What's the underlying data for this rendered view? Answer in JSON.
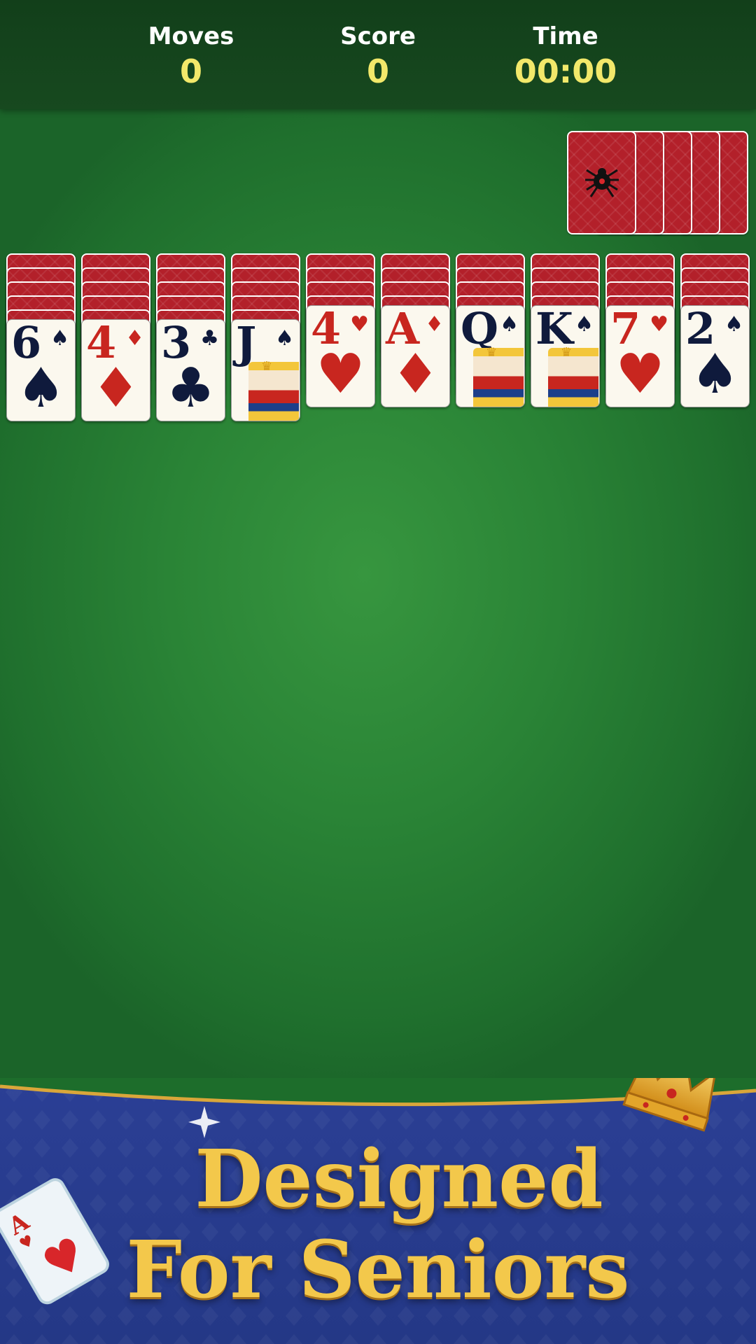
{
  "stats": {
    "moves_label": "Moves",
    "moves_value": "0",
    "score_label": "Score",
    "score_value": "0",
    "time_label": "Time",
    "time_value": "00:00"
  },
  "stock": {
    "piles": 5,
    "card_back": "red-spider-web"
  },
  "tableau": [
    {
      "facedown": 5,
      "rank": "6",
      "suit": "♠",
      "color": "black",
      "court": false
    },
    {
      "facedown": 5,
      "rank": "4",
      "suit": "♦",
      "color": "red",
      "court": false
    },
    {
      "facedown": 5,
      "rank": "3",
      "suit": "♣",
      "color": "black",
      "court": false
    },
    {
      "facedown": 5,
      "rank": "J",
      "suit": "♠",
      "color": "black",
      "court": true
    },
    {
      "facedown": 4,
      "rank": "4",
      "suit": "♥",
      "color": "red",
      "court": false
    },
    {
      "facedown": 4,
      "rank": "A",
      "suit": "♦",
      "color": "red",
      "court": false
    },
    {
      "facedown": 4,
      "rank": "Q",
      "suit": "♠",
      "color": "black",
      "court": true
    },
    {
      "facedown": 4,
      "rank": "K",
      "suit": "♠",
      "color": "black",
      "court": true
    },
    {
      "facedown": 4,
      "rank": "7",
      "suit": "♥",
      "color": "red",
      "court": false
    },
    {
      "facedown": 4,
      "rank": "2",
      "suit": "♠",
      "color": "black",
      "court": false
    }
  ],
  "banner": {
    "line1": "Designed",
    "line2": "For Seniors",
    "ace_rank": "A",
    "ace_suit": "♥",
    "crown_icon": "crown-icon"
  },
  "colors": {
    "felt": "#2a8436",
    "header": "#123f1a",
    "card_back": "#b3202a",
    "banner": "#2b3f95",
    "gold": "#f3c84b",
    "stat_value": "#f2e86a"
  }
}
